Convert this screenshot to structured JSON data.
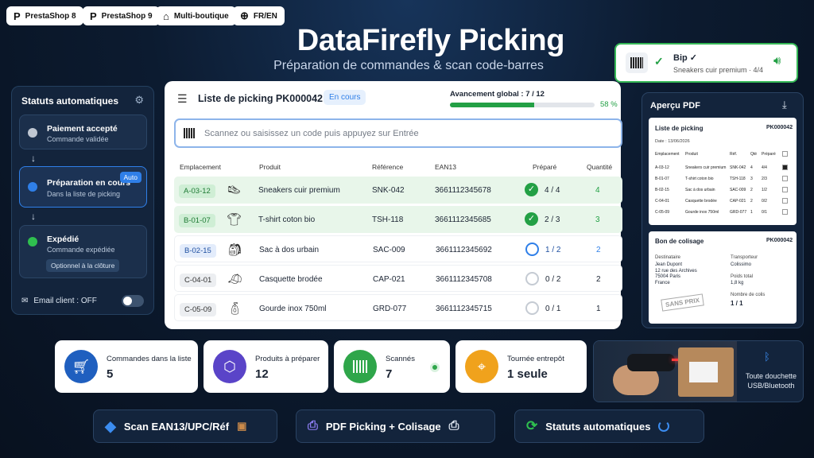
{
  "badges": [
    {
      "icon": "P",
      "label": "PrestaShop 8"
    },
    {
      "icon": "P",
      "label": "PrestaShop 9"
    },
    {
      "icon": "⌂",
      "label": "Multi-boutique"
    },
    {
      "icon": "⊕",
      "label": "FR/EN"
    }
  ],
  "hero": {
    "title": "DataFirefly Picking",
    "subtitle": "Préparation de commandes & scan code-barres"
  },
  "statuts": {
    "title": "Statuts automatiques",
    "steps": [
      {
        "title": "Paiement accepté",
        "sub": "Commande validée",
        "color": "#bfc7d2"
      },
      {
        "title": "Préparation en cours",
        "sub": "Dans la liste de picking",
        "color": "#2f7fe8",
        "badge": "Auto"
      },
      {
        "title": "Expédié",
        "sub": "Commande expédiée",
        "color": "#2fbf4f",
        "option": "Optionnel à la clôture"
      }
    ],
    "email": "Email client : OFF"
  },
  "picking": {
    "title": "Liste de picking PK000042",
    "status": "En cours",
    "progress_label": "Avancement global : 7 / 12",
    "progress_pct": "58 %",
    "progress_value": 0.58,
    "scan_placeholder": "Scannez ou saisissez un code puis appuyez sur Entrée",
    "columns": [
      "Emplacement",
      "Produit",
      "Référence",
      "EAN13",
      "Préparé",
      "Quantité"
    ],
    "rows": [
      {
        "loc": "A-03-12",
        "product": "Sneakers cuir premium",
        "ref": "SNK-042",
        "ean": "3661112345678",
        "prepared": "4 / 4",
        "qty": "4",
        "state": "done"
      },
      {
        "loc": "B-01-07",
        "product": "T-shirt coton bio",
        "ref": "TSH-118",
        "ean": "3661112345685",
        "prepared": "2 / 3",
        "qty": "3",
        "state": "done"
      },
      {
        "loc": "B-02-15",
        "product": "Sac à dos urbain",
        "ref": "SAC-009",
        "ean": "3661112345692",
        "prepared": "1 / 2",
        "qty": "2",
        "state": "active"
      },
      {
        "loc": "C-04-01",
        "product": "Casquette brodée",
        "ref": "CAP-021",
        "ean": "3661112345708",
        "prepared": "0 / 2",
        "qty": "2",
        "state": "todo"
      },
      {
        "loc": "C-05-09",
        "product": "Gourde inox 750ml",
        "ref": "GRD-077",
        "ean": "3661112345715",
        "prepared": "0 / 1",
        "qty": "1",
        "state": "todo"
      }
    ]
  },
  "stats": [
    {
      "label": "Commandes dans la liste",
      "value": "5",
      "color": "#1f5fbf",
      "icon": "cart-icon"
    },
    {
      "label": "Produits à préparer",
      "value": "12",
      "color": "#5a44c8",
      "icon": "box-icon"
    },
    {
      "label": "Scannés",
      "value": "7",
      "color": "#2fa64a",
      "icon": "barcode-icon"
    },
    {
      "label": "Tournée entrepôt",
      "value": "1 seule",
      "color": "#f0a21c",
      "icon": "route-icon"
    }
  ],
  "features": [
    {
      "label": "Scan EAN13/UPC/Réf"
    },
    {
      "label": "PDF Picking + Colisage"
    },
    {
      "label": "Statuts automatiques"
    }
  ],
  "bip": {
    "title": "Bip ✓",
    "sub": "Sneakers cuir premium · 4/4"
  },
  "pdf": {
    "title": "Aperçu PDF",
    "picking": {
      "title": "Liste de picking",
      "id": "PK000042",
      "date": "Date : 13/06/2026",
      "cols": [
        "Emplacement",
        "Produit",
        "Réf.",
        "Qté",
        "Préparé"
      ],
      "rows": [
        [
          "A-03-12",
          "Sneakers cuir premium",
          "SNK-042",
          "4",
          "4/4"
        ],
        [
          "B-01-07",
          "T-shirt coton bio",
          "TSH-118",
          "3",
          "2/3"
        ],
        [
          "B-02-15",
          "Sac à dos urbain",
          "SAC-009",
          "2",
          "1/2"
        ],
        [
          "C-04-01",
          "Casquette brodée",
          "CAP-021",
          "2",
          "0/2"
        ],
        [
          "C-05-09",
          "Gourde inox 750ml",
          "GRD-077",
          "1",
          "0/1"
        ]
      ]
    },
    "colisage": {
      "title": "Bon de colisage",
      "id": "PK000042",
      "dest_label": "Destinataire",
      "dest": [
        "Jean Dupont",
        "12 rue des Archives",
        "75004 Paris",
        "France"
      ],
      "trans_label": "Transporteur",
      "trans": "Colissimo",
      "poids_label": "Poids total",
      "poids": "1,8 kg",
      "colis_label": "Nombre de colis",
      "colis": "1 / 1",
      "stamp": "SANS PRIX"
    }
  },
  "scanner": {
    "label": "Toute douchette USB/Bluetooth"
  }
}
